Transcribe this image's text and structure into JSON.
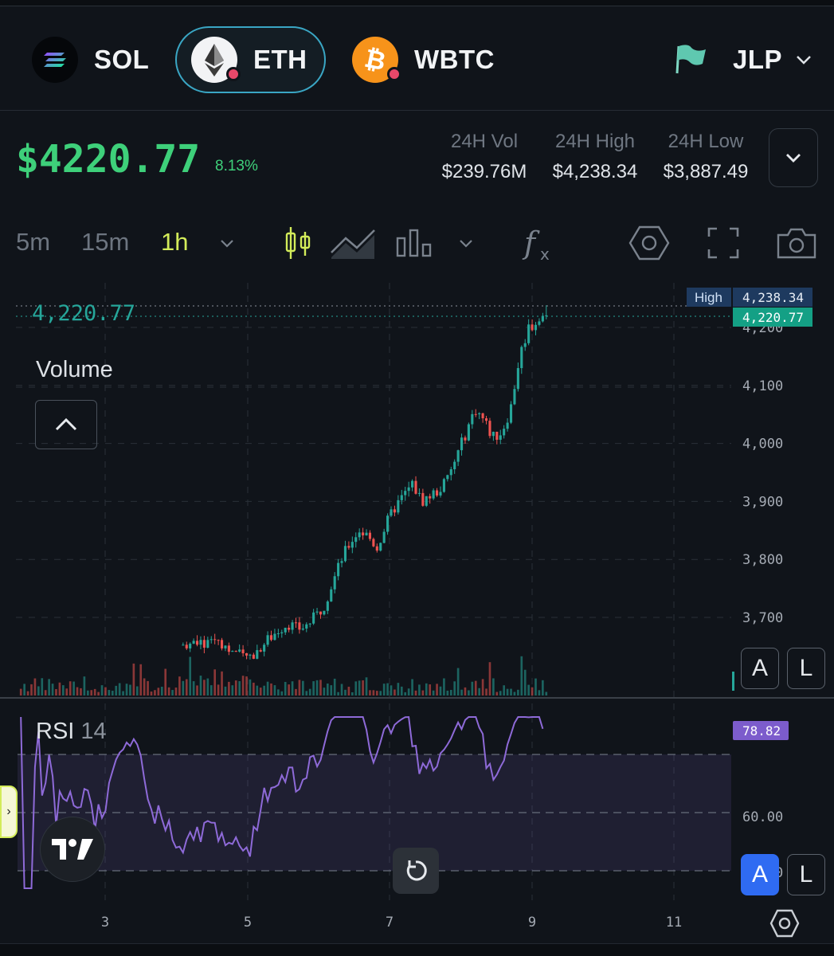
{
  "tokens": [
    {
      "symbol": "SOL",
      "selected": false
    },
    {
      "symbol": "ETH",
      "selected": true
    },
    {
      "symbol": "WBTC",
      "selected": false
    },
    {
      "symbol": "JLP",
      "selected": false
    }
  ],
  "price": {
    "current": "$4220.77",
    "change": "8.13%"
  },
  "stats": {
    "vol": {
      "label": "24H Vol",
      "value": "$239.76M"
    },
    "high": {
      "label": "24H High",
      "value": "$4,238.34"
    },
    "low": {
      "label": "24H Low",
      "value": "$3,887.49"
    }
  },
  "toolbar": {
    "timeframes": [
      "5m",
      "15m",
      "1h"
    ],
    "active_timeframe": "1h",
    "icons": [
      "chevron-down-icon",
      "candlestick-icon",
      "area-chart-icon",
      "bar-chart-icon",
      "chevron-down-icon",
      "indicator-fx-icon",
      "settings-hex-icon",
      "fullscreen-icon",
      "camera-icon"
    ]
  },
  "chart": {
    "current_line_label": "4,220.77",
    "high_tag": {
      "label": "High",
      "value": "4,238.34"
    },
    "current_tag": "4,220.77",
    "y_axis": [
      "4,200",
      "4,100",
      "4,000",
      "3,900",
      "3,800",
      "3,700"
    ],
    "volume_label": "Volume",
    "rsi": {
      "label": "RSI",
      "period": "14",
      "value_tag": "78.82",
      "y_axis": [
        "60.00",
        "40.00"
      ]
    },
    "x_axis": [
      "3",
      "5",
      "7",
      "9",
      "11"
    ],
    "buttons": {
      "auto": "A",
      "log": "L"
    },
    "colors": {
      "up": "#26a69a",
      "down": "#ef5350",
      "rsi": "#8e6ad8",
      "accent": "#d3ec5a",
      "price_green": "#3ed07a"
    }
  },
  "chart_data": {
    "type": "candlestick",
    "title": "",
    "xlabel": "",
    "ylabel": "",
    "x_ticks": [
      "3",
      "5",
      "7",
      "9",
      "11"
    ],
    "ylim": [
      3650,
      4260
    ],
    "y_ticks": [
      4200,
      4100,
      4000,
      3900,
      3800,
      3700
    ],
    "close_path": [
      3650,
      3652,
      3655,
      3660,
      3655,
      3650,
      3652,
      3658,
      3655,
      3650,
      3660,
      3700,
      3720,
      3730,
      3710,
      3690,
      3680,
      3670,
      3660,
      3655,
      3650,
      3660,
      3665,
      3650,
      3640,
      3630,
      3635,
      3650,
      3665,
      3680,
      3690,
      3680,
      3685,
      3700,
      3720,
      3760,
      3800,
      3830,
      3850,
      3840,
      3820,
      3860,
      3890,
      3910,
      3930,
      3900,
      3910,
      3920,
      3940,
      3980,
      4020,
      4060,
      4040,
      4010,
      4020,
      4060,
      4150,
      4200,
      4210,
      4220.77
    ],
    "high": 4238.34,
    "last": 4220.77,
    "rsi": {
      "period": 14,
      "last": 78.82,
      "levels": [
        70,
        50,
        30
      ]
    }
  }
}
